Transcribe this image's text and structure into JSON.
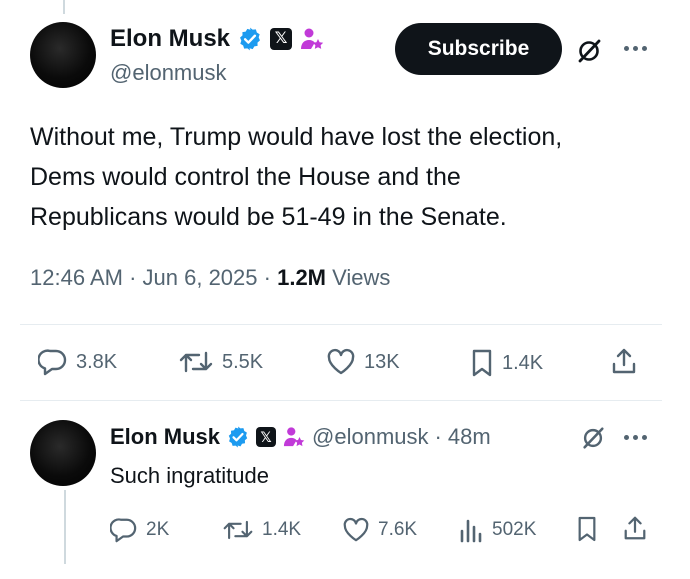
{
  "main_tweet": {
    "author": {
      "name": "Elon Musk",
      "handle": "@elonmusk"
    },
    "subscribe_label": "Subscribe",
    "text_lines": [
      "Without me, Trump would have lost the election,",
      "Dems would control the House and the",
      "Republicans would be 51-49 in the Senate."
    ],
    "time": "12:46 AM",
    "date": "Jun 6, 2025",
    "views_count": "1.2M",
    "views_label": "Views",
    "actions": {
      "replies": "3.8K",
      "reposts": "5.5K",
      "likes": "13K",
      "bookmarks": "1.4K"
    }
  },
  "reply_tweet": {
    "author": {
      "name": "Elon Musk",
      "handle": "@elonmusk"
    },
    "age": "48m",
    "text": "Such ingratitude",
    "actions": {
      "replies": "2K",
      "reposts": "1.4K",
      "likes": "7.6K",
      "views": "502K"
    }
  },
  "colors": {
    "verified": "#1d9bf0",
    "affiliate": "#c13ad8",
    "text": "#0f1419",
    "muted": "#536471"
  }
}
